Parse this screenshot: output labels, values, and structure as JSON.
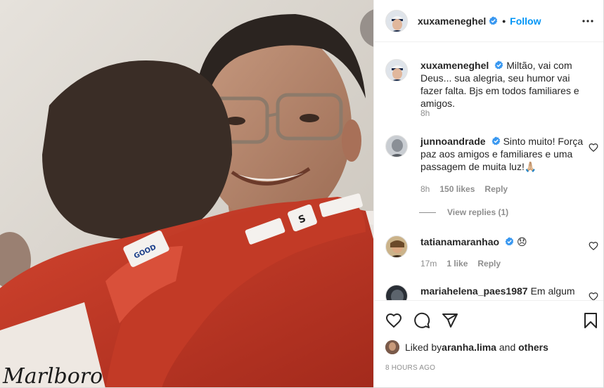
{
  "post": {
    "author": "xuxameneghel",
    "follow_label": "Follow",
    "separator": "•",
    "photo_description": "Photo of two men embracing; one wears red racing suit",
    "photo_visible_text": [
      "Marlboro",
      "GOOD",
      "S"
    ]
  },
  "caption": {
    "username": "xuxameneghel",
    "text": "Miltão, vai com Deus... sua alegria, seu humor vai fazer falta. Bjs em todos familiares e amigos.",
    "time": "8h"
  },
  "comments": [
    {
      "username": "junnoandrade",
      "verified": true,
      "text": "Sinto muito! Força paz aos amigos e familiares e uma passagem de muita luz!🙏🏼",
      "time": "8h",
      "likes": "150 likes",
      "reply": "Reply",
      "view_replies": "View replies (1)"
    },
    {
      "username": "tatianamaranhao",
      "verified": true,
      "text": "😞",
      "time": "17m",
      "likes": "1 like",
      "reply": "Reply"
    },
    {
      "username": "mariahelena_paes1987",
      "verified": false,
      "text": "Em algum"
    }
  ],
  "liked_by": {
    "prefix": "Liked by ",
    "user": "aranha.lima",
    "and": " and ",
    "others": "others"
  },
  "timestamp": "8 HOURS AGO",
  "colors": {
    "accent": "#0095f6",
    "verified": "#3897f0",
    "text": "#262626",
    "muted": "#8e8e8e",
    "border": "#efefef"
  },
  "icons": [
    "verified-badge-icon",
    "more-options-icon",
    "heart-icon",
    "comment-icon",
    "share-icon",
    "save-bookmark-icon"
  ]
}
